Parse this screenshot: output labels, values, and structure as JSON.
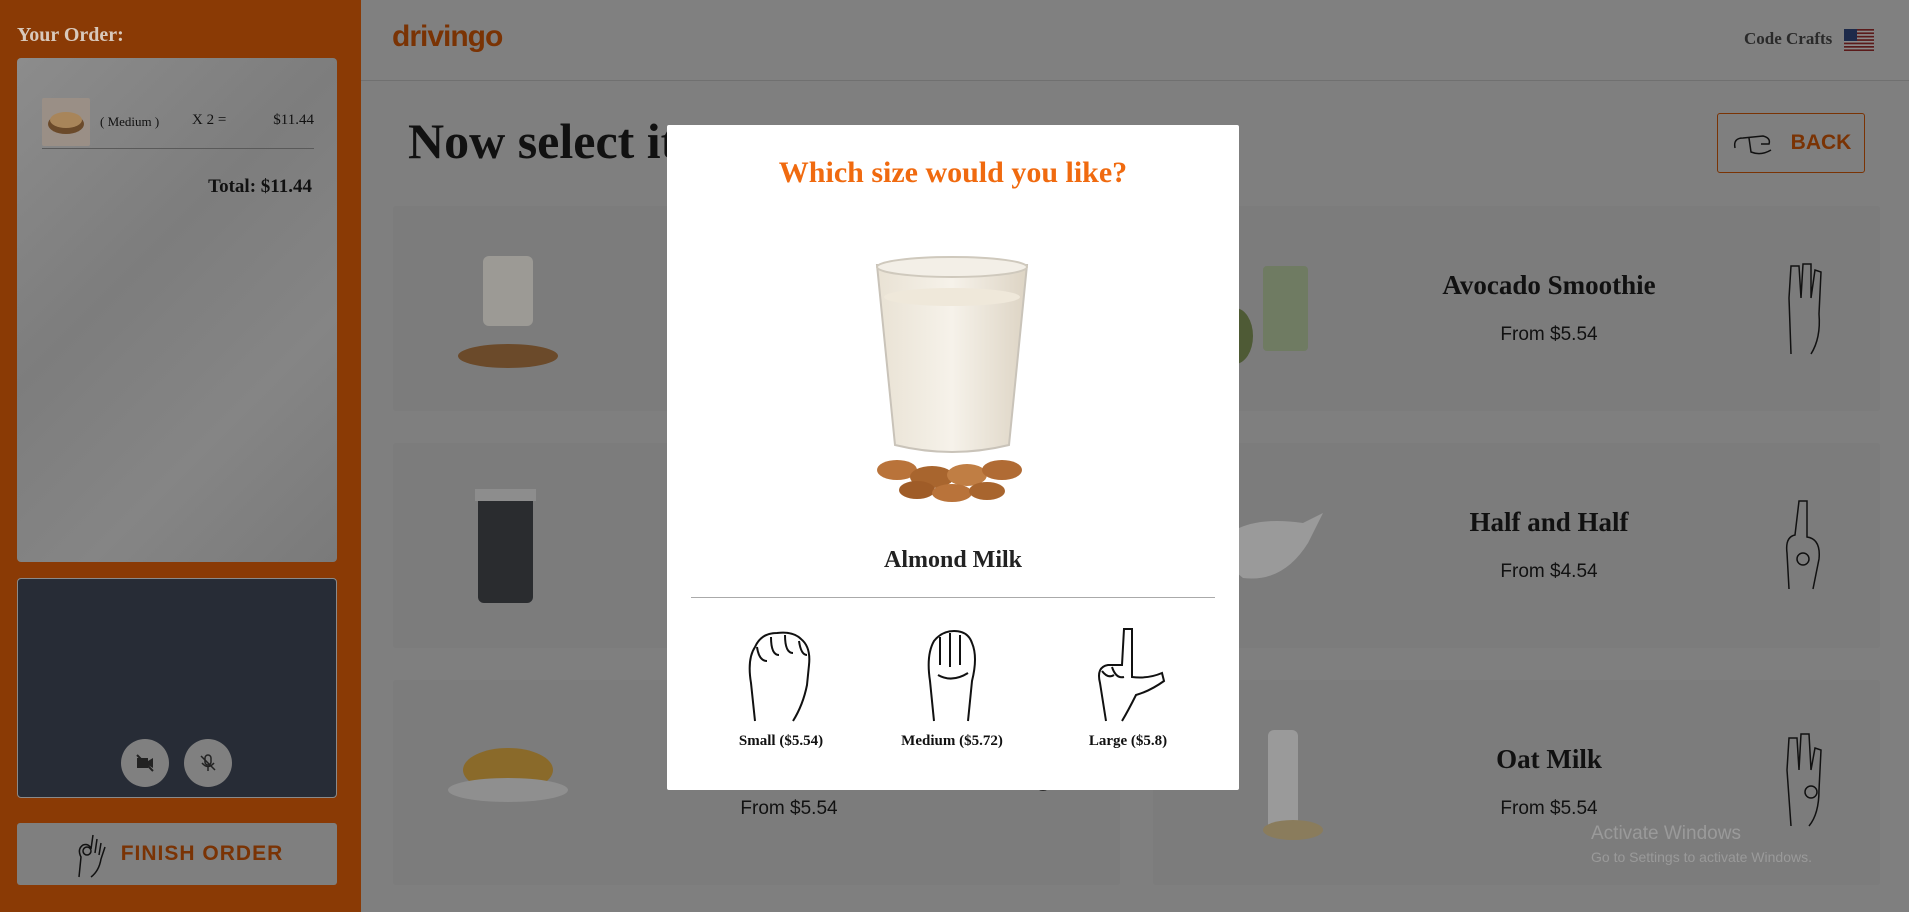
{
  "sidebar": {
    "title": "Your Order:",
    "order_item": {
      "size": "( Medium )",
      "qty": "X  2  =",
      "price": "$11.44"
    },
    "total": "Total: $11.44",
    "finish_label": "FINISH ORDER"
  },
  "header": {
    "logo": "drivingo",
    "brand": "Code Crafts"
  },
  "main": {
    "title": "Now select it",
    "back_label": "BACK",
    "cards": [
      {
        "name": "",
        "price": ""
      },
      {
        "name": "Avocado Smoothie",
        "price": "From $5.54"
      },
      {
        "name": "",
        "price": ""
      },
      {
        "name": "Half and Half",
        "price": "From $4.54"
      },
      {
        "name": "",
        "price": "From $5.54"
      },
      {
        "name": "Oat Milk",
        "price": "From $5.54"
      }
    ]
  },
  "modal": {
    "title": "Which size would you like?",
    "product": "Almond Milk",
    "sizes": [
      {
        "label": "Small ($5.54)"
      },
      {
        "label": "Medium ($5.72)"
      },
      {
        "label": "Large ($5.8)"
      }
    ]
  },
  "watermark": {
    "line1": "Activate Windows",
    "line2": "Go to Settings to activate Windows."
  },
  "colors": {
    "accent": "#f06a0f",
    "sidebar": "#8a3a05",
    "overlay": "#7f7f7f"
  }
}
